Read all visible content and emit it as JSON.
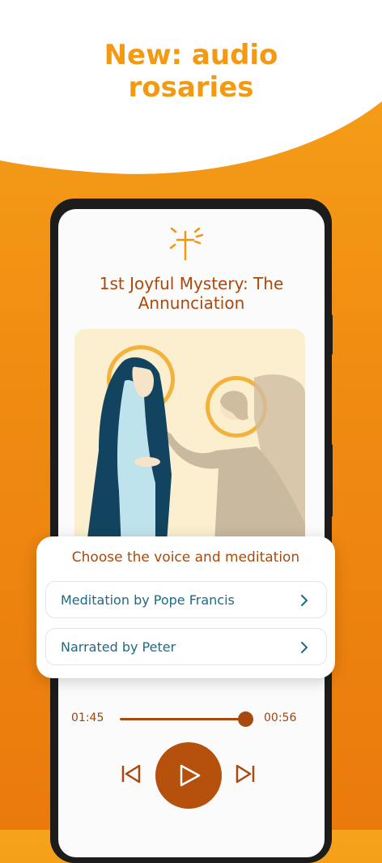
{
  "banner": {
    "headline_line1": "New: audio",
    "headline_line2": "rosaries"
  },
  "screen": {
    "title_line1": "1st Joyful Mystery: The",
    "title_line2": "Annunciation"
  },
  "player": {
    "elapsed": "01:45",
    "remaining": "00:56",
    "progress": 0.82
  },
  "voice_card": {
    "title": "Choose the voice and meditation",
    "options": [
      {
        "label": "Meditation by Pope Francis"
      },
      {
        "label": "Narrated by Peter"
      }
    ]
  },
  "colors": {
    "accent": "#f39a12",
    "brown": "#a84a0e",
    "link": "#1c6a86"
  },
  "icons": [
    "cross-icon",
    "skip-previous-icon",
    "play-icon",
    "skip-next-icon",
    "chevron-right-icon"
  ]
}
